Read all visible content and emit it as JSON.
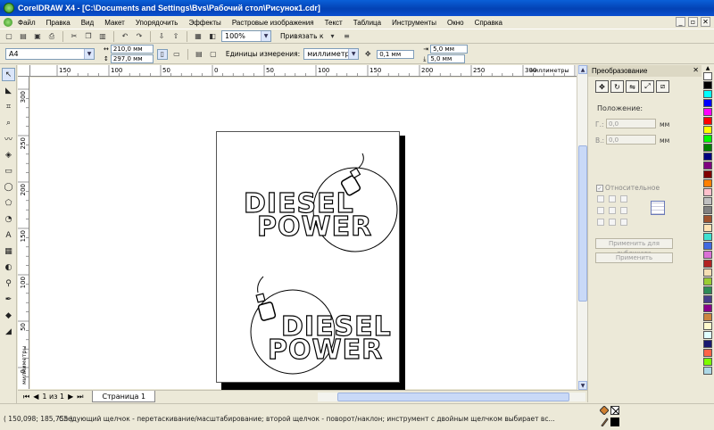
{
  "window": {
    "title": "CorelDRAW X4 - [C:\\Documents and Settings\\Bvs\\Рабочий стол\\Рисунок1.cdr]"
  },
  "menu": [
    "Файл",
    "Правка",
    "Вид",
    "Макет",
    "Упорядочить",
    "Эффекты",
    "Растровые изображения",
    "Текст",
    "Таблица",
    "Инструменты",
    "Окно",
    "Справка"
  ],
  "toolbar": {
    "zoom": "100%",
    "snap_label": "Привязать к"
  },
  "property_bar": {
    "paper_size": "A4",
    "width": "210,0 мм",
    "height": "297,0 мм",
    "units_label": "Единицы измерения:",
    "units": "миллиметры",
    "nudge": "0,1 мм",
    "dup_x": "5,0 мм",
    "dup_y": "5,0 мм"
  },
  "rulers": {
    "top_ticks": [
      "150",
      "100",
      "50",
      "0",
      "50",
      "100",
      "150",
      "200",
      "250",
      "300",
      "350"
    ],
    "left_ticks": [
      "300",
      "250",
      "200",
      "150",
      "100",
      "50",
      "0"
    ],
    "units_label": "миллиметры"
  },
  "drawing": {
    "logo1_line1": "DIESEL",
    "logo1_line2": "POWER",
    "logo2_line1": "DIESEL",
    "logo2_line2": "POWER"
  },
  "page_nav": {
    "counter": "1 из 1",
    "tab": "Страница 1"
  },
  "docker": {
    "title": "Преобразование",
    "position_label": "Положение:",
    "h_label": "Г.:",
    "h_value": "0,0",
    "v_label": "В.:",
    "v_value": "0,0",
    "unit": "мм",
    "relative_label": "Относительное",
    "apply_dup": "Применить для дубликата",
    "apply": "Применить"
  },
  "palette": [
    "#ffffff",
    "#000000",
    "#00ffff",
    "#0000ff",
    "#ff00ff",
    "#ff0000",
    "#ffff00",
    "#00ff00",
    "#008000",
    "#000080",
    "#800080",
    "#800000",
    "#ff8000",
    "#ffc0cb",
    "#c0c0c0",
    "#808080",
    "#a0522d",
    "#ffe4b5",
    "#40e0d0",
    "#4169e1",
    "#da70d6",
    "#b22222",
    "#f5deb3",
    "#9acd32",
    "#2e8b57",
    "#483d8b",
    "#8b008b",
    "#cd853f",
    "#fffacd",
    "#e0ffff",
    "#191970",
    "#ff6347",
    "#7cfc00",
    "#add8e6"
  ],
  "status": {
    "coords": "( 150,098; 185,755 )",
    "hint": "Следующий щелчок - перетаскивание/масштабирование; второй щелчок - поворот/наклон; инструмент с двойным щелчком выбирает вс..."
  }
}
